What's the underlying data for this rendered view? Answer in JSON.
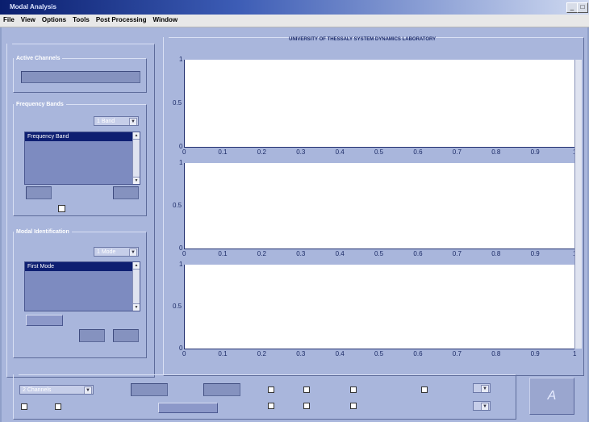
{
  "window": {
    "title": "Modal Analysis",
    "min_btn": "_",
    "max_btn": "□",
    "close_btn": "×"
  },
  "menu": [
    "File",
    "View",
    "Options",
    "Tools",
    "Post Processing",
    "Window"
  ],
  "left": {
    "experiment_legend": "",
    "active_channels": {
      "legend": "Active Channels"
    },
    "frequency_bands": {
      "legend": "Frequency Bands",
      "count_label": "",
      "count_value": "1 Band",
      "list_items": [
        "Frequency Band"
      ],
      "range_label": "",
      "checkbox_label": ""
    },
    "modal_identification": {
      "legend": "Modal Identification",
      "count_label": "",
      "count_value": "1 Mode",
      "list_items": [
        "First Mode"
      ],
      "button": "",
      "field_label": ""
    }
  },
  "plots": {
    "legend": "",
    "header": "UNIVERSITY OF THESSALY  SYSTEM DYNAMICS LABORATORY",
    "x_ticks": [
      "0",
      "0.1",
      "0.2",
      "0.3",
      "0.4",
      "0.5",
      "0.6",
      "0.7",
      "0.8",
      "0.9",
      "1"
    ],
    "y_ticks": [
      "0",
      "0.5",
      "1"
    ]
  },
  "bottom": {
    "legend": "",
    "channels_combo": "2 Channels",
    "label_a": "",
    "label_b": "",
    "compute_button": "",
    "options": [
      "",
      "",
      "",
      "",
      "",
      "",
      "",
      "",
      ""
    ],
    "right_label": "",
    "right_combo": ""
  },
  "run_button": "A"
}
